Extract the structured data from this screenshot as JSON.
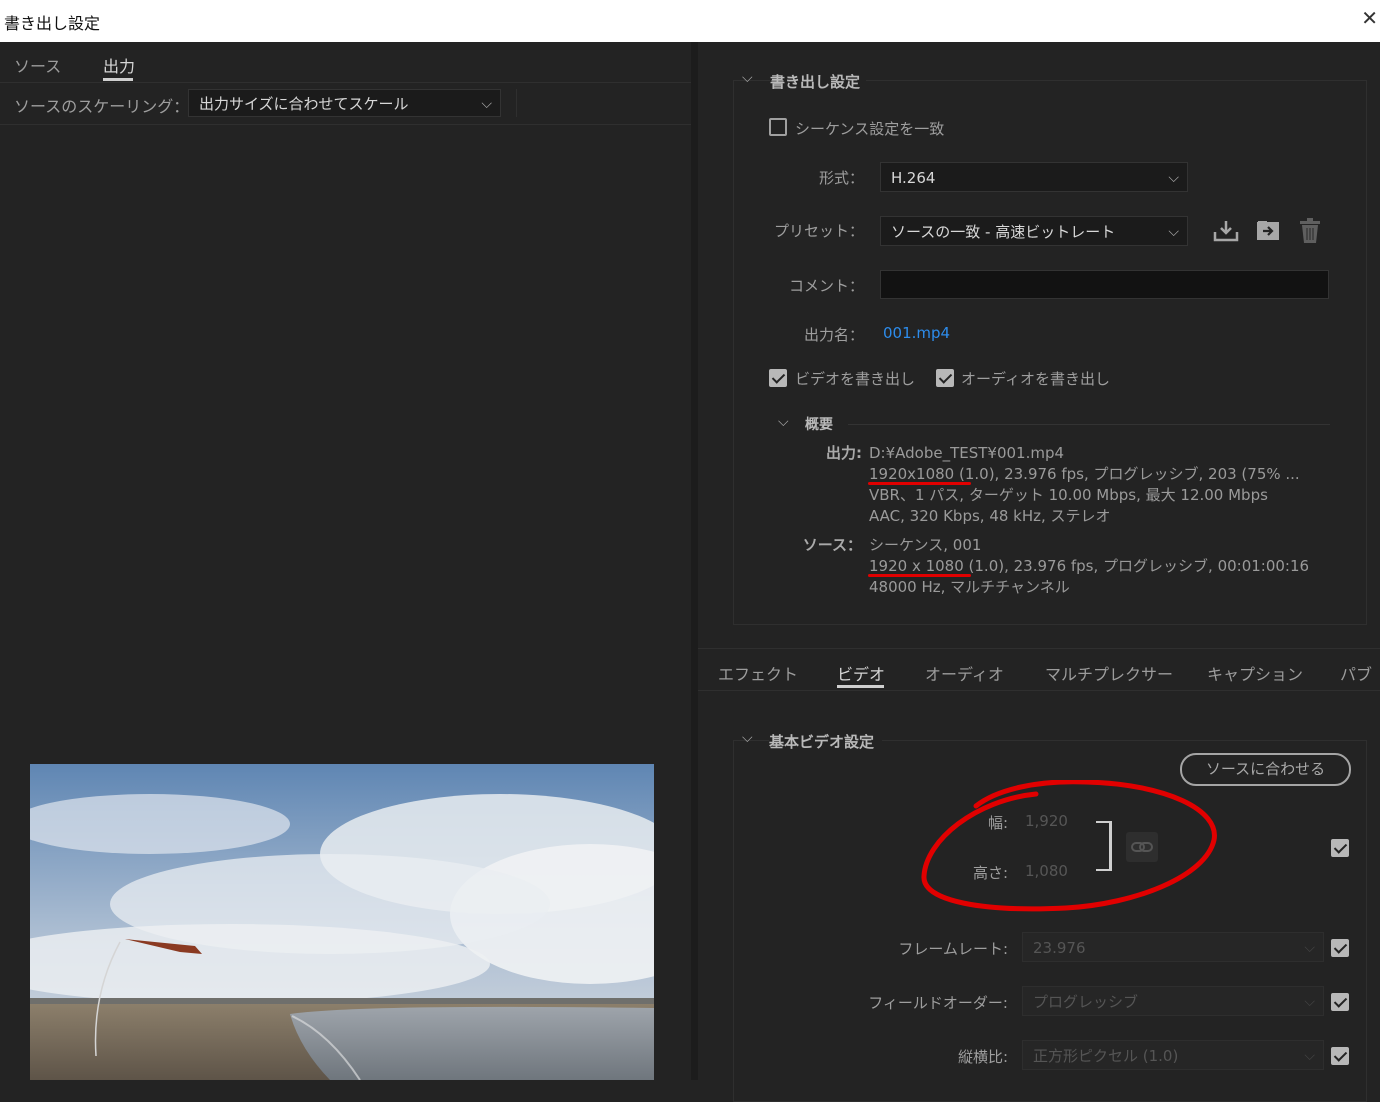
{
  "window": {
    "title": "書き出し設定",
    "close": "✕"
  },
  "left": {
    "tabs": [
      "ソース",
      "出力"
    ],
    "scaling_label": "ソースのスケーリング：",
    "scaling_value": "出力サイズに合わせてスケール"
  },
  "export_settings": {
    "section_title": "書き出し設定",
    "match_sequence": "シーケンス設定を一致",
    "format_label": "形式：",
    "format_value": "H.264",
    "preset_label": "プリセット：",
    "preset_value": "ソースの一致 - 高速ビットレート",
    "comment_label": "コメント：",
    "comment_value": "",
    "output_name_label": "出力名：",
    "output_name_value": "001.mp4",
    "export_video": "ビデオを書き出し",
    "export_audio": "オーディオを書き出し"
  },
  "summary": {
    "title": "概要",
    "output_label": "出力:",
    "output_lines": [
      "D:¥Adobe_TEST¥001.mp4",
      "1920x1080 (1.0), 23.976 fps, プログレッシブ, 203 (75% ...",
      "VBR、1 パス, ターゲット 10.00 Mbps, 最大 12.00 Mbps",
      "AAC, 320 Kbps, 48 kHz, ステレオ"
    ],
    "source_label": "ソース：",
    "source_lines": [
      "シーケンス, 001",
      "1920 x 1080 (1.0), 23.976 fps, プログレッシブ, 00:01:00:16",
      "48000 Hz, マルチチャンネル"
    ]
  },
  "bottom_tabs": [
    "エフェクト",
    "ビデオ",
    "オーディオ",
    "マルチプレクサー",
    "キャプション",
    "パブ"
  ],
  "video": {
    "section_title": "基本ビデオ設定",
    "match_source_button": "ソースに合わせる",
    "width_label": "幅:",
    "width_value": "1,920",
    "height_label": "高さ:",
    "height_value": "1,080",
    "framerate_label": "フレームレート:",
    "framerate_value": "23.976",
    "field_order_label": "フィールドオーダー:",
    "field_order_value": "プログレッシブ",
    "aspect_label": "縦横比:",
    "aspect_value": "正方形ピクセル (1.0)"
  },
  "colors": {
    "annotation_red": "#e10000",
    "link_blue": "#2d8ceb"
  }
}
